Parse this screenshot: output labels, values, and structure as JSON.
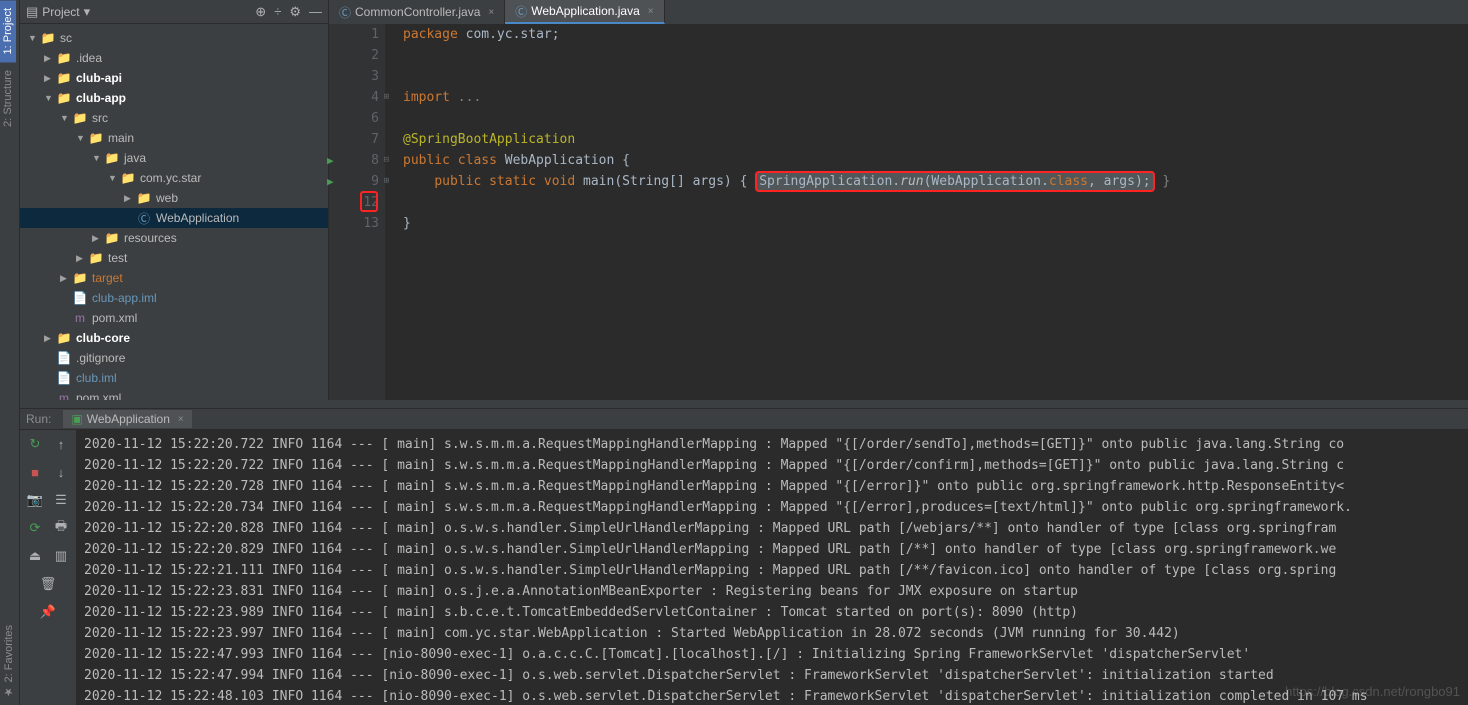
{
  "leftTabs": [
    "1: Project",
    "2: Structure"
  ],
  "favTab": "★ 2: Favorites",
  "projectHeader": {
    "title": "Project"
  },
  "tree": [
    {
      "indent": 8,
      "arrow": "▼",
      "icon": "📁",
      "iconCls": "folder",
      "label": "sc",
      "bold": false
    },
    {
      "indent": 24,
      "arrow": "▶",
      "icon": "📁",
      "iconCls": "folder",
      "label": ".idea",
      "bold": false
    },
    {
      "indent": 24,
      "arrow": "▶",
      "icon": "📁",
      "iconCls": "folder",
      "label": "club-api",
      "bold": true
    },
    {
      "indent": 24,
      "arrow": "▼",
      "icon": "📁",
      "iconCls": "folder",
      "label": "club-app",
      "bold": true
    },
    {
      "indent": 40,
      "arrow": "▼",
      "icon": "📁",
      "iconCls": "folder",
      "label": "src",
      "bold": false
    },
    {
      "indent": 56,
      "arrow": "▼",
      "icon": "📁",
      "iconCls": "folder",
      "label": "main",
      "bold": false
    },
    {
      "indent": 72,
      "arrow": "▼",
      "icon": "📁",
      "iconCls": "file-blue",
      "label": "java",
      "bold": false
    },
    {
      "indent": 88,
      "arrow": "▼",
      "icon": "📁",
      "iconCls": "folder",
      "label": "com.yc.star",
      "bold": false
    },
    {
      "indent": 104,
      "arrow": "▶",
      "icon": "📁",
      "iconCls": "folder",
      "label": "web",
      "bold": false
    },
    {
      "indent": 104,
      "arrow": "",
      "icon": "Ⓒ",
      "iconCls": "file-blue",
      "label": "WebApplication",
      "bold": false,
      "selected": true
    },
    {
      "indent": 72,
      "arrow": "▶",
      "icon": "📁",
      "iconCls": "folder",
      "label": "resources",
      "bold": false
    },
    {
      "indent": 56,
      "arrow": "▶",
      "icon": "📁",
      "iconCls": "folder",
      "label": "test",
      "bold": false
    },
    {
      "indent": 40,
      "arrow": "▶",
      "icon": "📁",
      "iconCls": "folder-orange",
      "label": "target",
      "bold": false,
      "orange": true
    },
    {
      "indent": 40,
      "arrow": "",
      "icon": "📄",
      "iconCls": "file-id",
      "label": "club-app.iml",
      "bold": false,
      "colored": "#6897bb"
    },
    {
      "indent": 40,
      "arrow": "",
      "icon": "m",
      "iconCls": "file-m",
      "label": "pom.xml",
      "bold": false
    },
    {
      "indent": 24,
      "arrow": "▶",
      "icon": "📁",
      "iconCls": "folder",
      "label": "club-core",
      "bold": true
    },
    {
      "indent": 24,
      "arrow": "",
      "icon": "📄",
      "iconCls": "folder",
      "label": ".gitignore",
      "bold": false
    },
    {
      "indent": 24,
      "arrow": "",
      "icon": "📄",
      "iconCls": "file-id",
      "label": "club.iml",
      "bold": false,
      "colored": "#6897bb"
    },
    {
      "indent": 24,
      "arrow": "",
      "icon": "m",
      "iconCls": "file-m",
      "label": "pom.xml",
      "bold": false
    }
  ],
  "tabs": [
    {
      "icon": "Ⓒ",
      "label": "CommonController.java",
      "active": false
    },
    {
      "icon": "Ⓒ",
      "label": "WebApplication.java",
      "active": true
    }
  ],
  "code": {
    "lines": [
      {
        "num": 1,
        "parts": [
          {
            "t": "package ",
            "c": "kw"
          },
          {
            "t": "com.yc.star",
            "c": "id"
          },
          {
            "t": ";",
            "c": "id"
          }
        ]
      },
      {
        "num": 2,
        "parts": []
      },
      {
        "num": 3,
        "parts": []
      },
      {
        "num": 4,
        "parts": [
          {
            "t": "import ",
            "c": "kw"
          },
          {
            "t": "...",
            "c": "com"
          }
        ],
        "fold": "⊞"
      },
      {
        "num": 6,
        "parts": []
      },
      {
        "num": 7,
        "parts": [
          {
            "t": "@SpringBootApplication",
            "c": "ann"
          }
        ]
      },
      {
        "num": 8,
        "parts": [
          {
            "t": "public class ",
            "c": "kw"
          },
          {
            "t": "WebApplication ",
            "c": "cls"
          },
          {
            "t": "{",
            "c": "id"
          }
        ],
        "run": true,
        "fold": "⊟"
      },
      {
        "num": 9,
        "parts": [
          {
            "t": "    ",
            "c": ""
          },
          {
            "t": "public static void ",
            "c": "kw"
          },
          {
            "t": "main",
            "c": "id"
          },
          {
            "t": "(String[] args) ",
            "c": "id"
          },
          {
            "t": "{ ",
            "c": "id"
          },
          {
            "t": "SpringApplication.",
            "c": "id",
            "box": true
          },
          {
            "t": "run",
            "c": "ital",
            "box": true
          },
          {
            "t": "(WebApplication.",
            "c": "id",
            "box": true
          },
          {
            "t": "class",
            "c": "kw",
            "box": true
          },
          {
            "t": ", args);",
            "c": "id",
            "box": true
          },
          {
            "t": " }",
            "c": "com"
          }
        ],
        "run": true,
        "fold": "⊞"
      },
      {
        "num": 12,
        "parts": []
      },
      {
        "num": 13,
        "parts": [
          {
            "t": "}",
            "c": "id"
          }
        ]
      }
    ]
  },
  "runHeader": {
    "label": "Run:",
    "tab": "WebApplication"
  },
  "console": [
    "2020-11-12 15:22:20.722  INFO 1164 --- [           main] s.w.s.m.m.a.RequestMappingHandlerMapping : Mapped \"{[/order/sendTo],methods=[GET]}\" onto public java.lang.String co",
    "2020-11-12 15:22:20.722  INFO 1164 --- [           main] s.w.s.m.m.a.RequestMappingHandlerMapping : Mapped \"{[/order/confirm],methods=[GET]}\" onto public java.lang.String c",
    "2020-11-12 15:22:20.728  INFO 1164 --- [           main] s.w.s.m.m.a.RequestMappingHandlerMapping : Mapped \"{[/error]}\" onto public org.springframework.http.ResponseEntity<",
    "2020-11-12 15:22:20.734  INFO 1164 --- [           main] s.w.s.m.m.a.RequestMappingHandlerMapping : Mapped \"{[/error],produces=[text/html]}\" onto public org.springframework.",
    "2020-11-12 15:22:20.828  INFO 1164 --- [           main] o.s.w.s.handler.SimpleUrlHandlerMapping  : Mapped URL path [/webjars/**] onto handler of type [class org.springfram",
    "2020-11-12 15:22:20.829  INFO 1164 --- [           main] o.s.w.s.handler.SimpleUrlHandlerMapping  : Mapped URL path [/**] onto handler of type [class org.springframework.we",
    "2020-11-12 15:22:21.111  INFO 1164 --- [           main] o.s.w.s.handler.SimpleUrlHandlerMapping  : Mapped URL path [/**/favicon.ico] onto handler of type [class org.spring",
    "2020-11-12 15:22:23.831  INFO 1164 --- [           main] o.s.j.e.a.AnnotationMBeanExporter        : Registering beans for JMX exposure on startup",
    "2020-11-12 15:22:23.989  INFO 1164 --- [           main] s.b.c.e.t.TomcatEmbeddedServletContainer : Tomcat started on port(s): 8090 (http)",
    "2020-11-12 15:22:23.997  INFO 1164 --- [           main] com.yc.star.WebApplication               : Started WebApplication in 28.072 seconds (JVM running for 30.442)",
    "2020-11-12 15:22:47.993  INFO 1164 --- [nio-8090-exec-1] o.a.c.c.C.[Tomcat].[localhost].[/]       : Initializing Spring FrameworkServlet 'dispatcherServlet'",
    "2020-11-12 15:22:47.994  INFO 1164 --- [nio-8090-exec-1] o.s.web.servlet.DispatcherServlet        : FrameworkServlet 'dispatcherServlet': initialization started",
    "2020-11-12 15:22:48.103  INFO 1164 --- [nio-8090-exec-1] o.s.web.servlet.DispatcherServlet        : FrameworkServlet 'dispatcherServlet': initialization completed in 107 ms"
  ],
  "watermark": "https://blog.csdn.net/rongbo91"
}
